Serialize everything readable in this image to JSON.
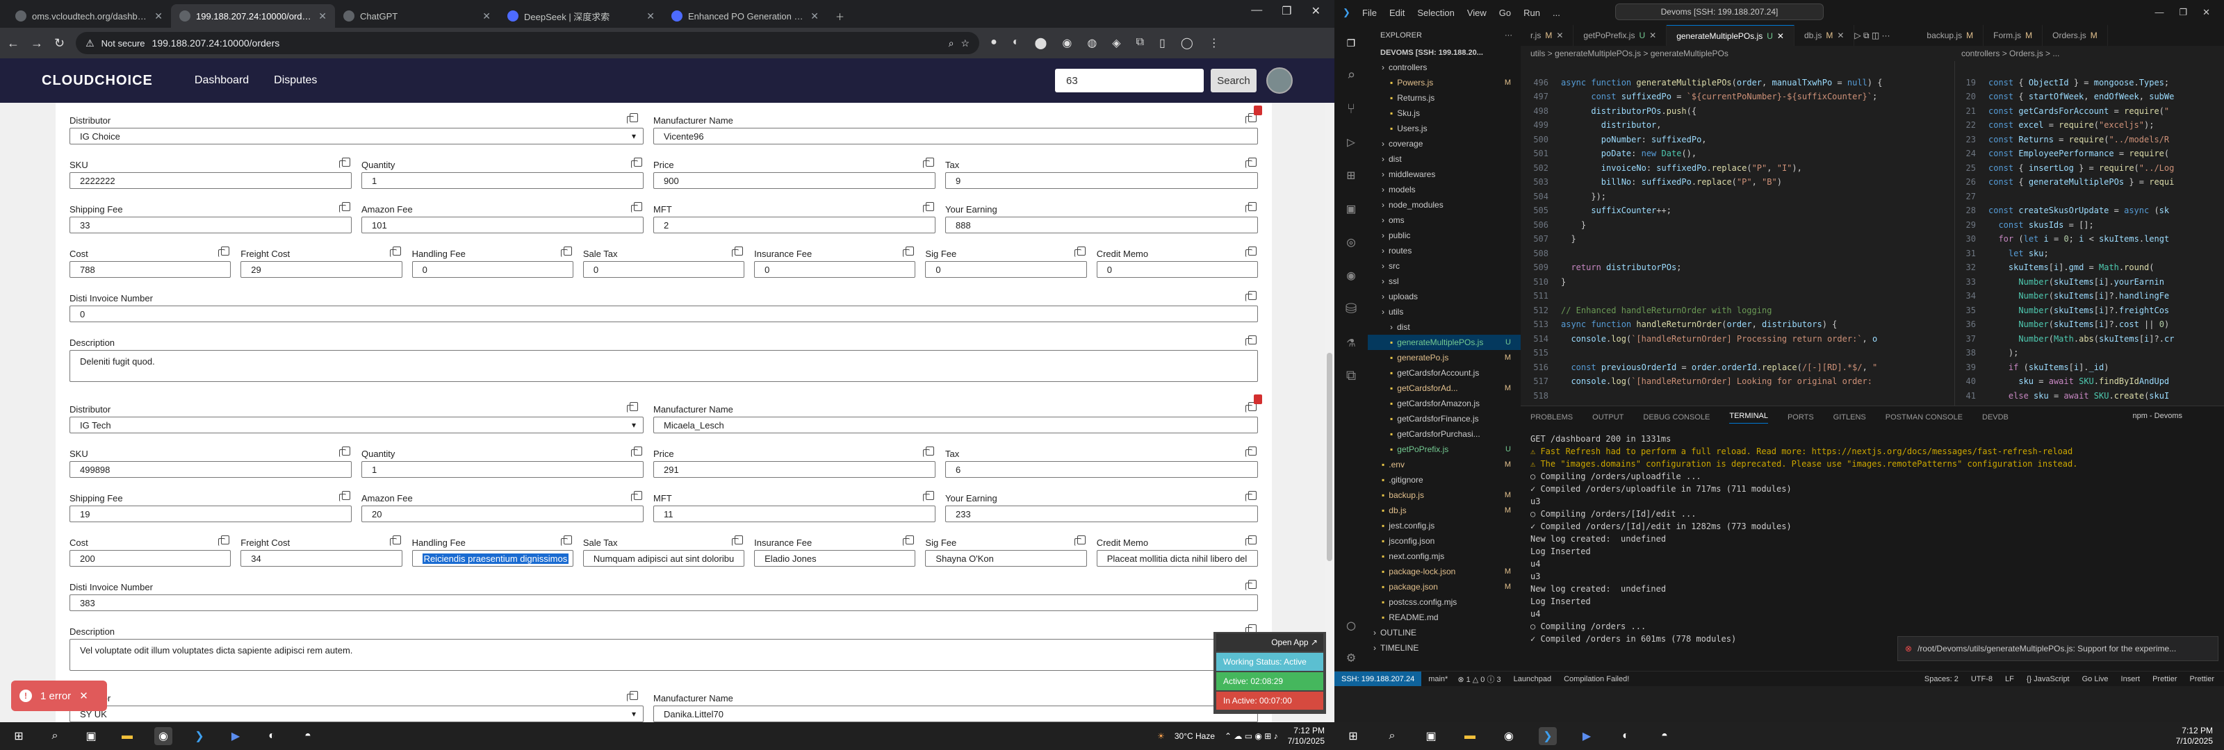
{
  "chrome": {
    "tabs": [
      {
        "title": "oms.vcloudtech.org/dashboard",
        "active": false
      },
      {
        "title": "199.188.207.24:10000/orders",
        "active": true
      },
      {
        "title": "ChatGPT",
        "active": false
      },
      {
        "title": "DeepSeek | 深度求索",
        "active": false
      },
      {
        "title": "Enhanced PO Generation for M",
        "active": false
      }
    ],
    "url_warning": "Not secure",
    "url": "199.188.207.24:10000/orders"
  },
  "app": {
    "logo": "CLOUDCHOICE",
    "nav": [
      "Dashboard",
      "Disputes"
    ],
    "search_value": "63",
    "search_button": "Search"
  },
  "labels": {
    "distributor": "Distributor",
    "manufacturer": "Manufacturer Name",
    "sku": "SKU",
    "quantity": "Quantity",
    "price": "Price",
    "tax": "Tax",
    "shipping": "Shipping Fee",
    "amazon": "Amazon Fee",
    "mft": "MFT",
    "earning": "Your Earning",
    "cost": "Cost",
    "freight": "Freight Cost",
    "handling": "Handling Fee",
    "saletax": "Sale Tax",
    "insurance": "Insurance Fee",
    "sig": "Sig Fee",
    "credit": "Credit Memo",
    "disti": "Disti Invoice Number",
    "description": "Description"
  },
  "items": [
    {
      "distributor": "IG Choice",
      "manufacturer": "Vicente96",
      "sku": "2222222",
      "quantity": "1",
      "price": "900",
      "tax": "9",
      "shipping": "33",
      "amazon": "101",
      "mft": "2",
      "earning": "888",
      "cost": "788",
      "freight": "29",
      "handling": "0",
      "saletax": "0",
      "insurance": "0",
      "sig": "0",
      "credit": "0",
      "disti": "0",
      "description": "Deleniti fugit quod."
    },
    {
      "distributor": "IG Tech",
      "manufacturer": "Micaela_Lesch",
      "sku": "499898",
      "quantity": "1",
      "price": "291",
      "tax": "6",
      "shipping": "19",
      "amazon": "20",
      "mft": "11",
      "earning": "233",
      "cost": "200",
      "freight": "34",
      "handling": "Reiciendis praesentium dignissimos",
      "saletax": "Numquam adipisci aut sint doloribu",
      "insurance": "Eladio Jones",
      "sig": "Shayna O'Kon",
      "credit": "Placeat mollitia dicta nihil libero del",
      "disti": "383",
      "description": "Vel voluptate odit illum voluptates dicta sapiente adipisci rem autem."
    },
    {
      "distributor": "SY UK",
      "manufacturer": "Danika.Littel70"
    }
  ],
  "overlay": {
    "error_count": "1 error",
    "open_app": "Open App ↗",
    "working": "Working Status: Active",
    "active": "Active: 02:08:29",
    "inactive": "In Active: 00:07:00"
  },
  "taskbar_left": {
    "weather": "30°C Haze",
    "time": "7:12 PM",
    "date": "7/10/2025"
  },
  "vscode": {
    "menu": [
      "File",
      "Edit",
      "Selection",
      "View",
      "Go",
      "Run",
      "..."
    ],
    "search": "Devoms [SSH: 199.188.207.24]",
    "explorer_title": "EXPLORER",
    "workspace": "DEVOMS [SSH: 199.188.20...",
    "files": [
      {
        "name": "controllers",
        "badge": "",
        "folder": true
      },
      {
        "name": "Powers.js",
        "badge": "M"
      },
      {
        "name": "Returns.js",
        "badge": ""
      },
      {
        "name": "Sku.js",
        "badge": ""
      },
      {
        "name": "Users.js",
        "badge": ""
      },
      {
        "name": "coverage",
        "badge": "",
        "folder": true
      },
      {
        "name": "dist",
        "badge": "",
        "folder": true
      },
      {
        "name": "middlewares",
        "badge": "",
        "folder": true
      },
      {
        "name": "models",
        "badge": "",
        "folder": true
      },
      {
        "name": "node_modules",
        "badge": "",
        "folder": true
      },
      {
        "name": "oms",
        "badge": "",
        "folder": true
      },
      {
        "name": "public",
        "badge": "",
        "folder": true
      },
      {
        "name": "routes",
        "badge": "",
        "folder": true
      },
      {
        "name": "src",
        "badge": "",
        "folder": true
      },
      {
        "name": "ssl",
        "badge": "",
        "folder": true
      },
      {
        "name": "uploads",
        "badge": "",
        "folder": true
      },
      {
        "name": "utils",
        "badge": "",
        "folder": true
      },
      {
        "name": "dist",
        "badge": "",
        "folder": true
      },
      {
        "name": "generateMultiplePOs.js",
        "badge": "U"
      },
      {
        "name": "generatePo.js",
        "badge": "M"
      },
      {
        "name": "getCardsforAccount.js",
        "badge": ""
      },
      {
        "name": "getCardsforAd...",
        "badge": "M"
      },
      {
        "name": "getCardsforAmazon.js",
        "badge": ""
      },
      {
        "name": "getCardsforFinance.js",
        "badge": ""
      },
      {
        "name": "getCardsforPurchasi...",
        "badge": ""
      },
      {
        "name": "getPoPrefix.js",
        "badge": "U"
      },
      {
        "name": ".env",
        "badge": "M"
      },
      {
        "name": ".gitignore",
        "badge": ""
      },
      {
        "name": "backup.js",
        "badge": "M"
      },
      {
        "name": "db.js",
        "badge": "M"
      },
      {
        "name": "jest.config.js",
        "badge": ""
      },
      {
        "name": "jsconfig.json",
        "badge": ""
      },
      {
        "name": "next.config.mjs",
        "badge": ""
      },
      {
        "name": "package-lock.json",
        "badge": "M"
      },
      {
        "name": "package.json",
        "badge": "M"
      },
      {
        "name": "postcss.config.mjs",
        "badge": ""
      },
      {
        "name": "README.md",
        "badge": ""
      },
      {
        "name": "OUTLINE",
        "badge": "",
        "folder": true
      },
      {
        "name": "TIMELINE",
        "badge": "",
        "folder": true
      }
    ],
    "tabs_left": [
      {
        "name": "r.js",
        "badge": "M",
        "active": false
      },
      {
        "name": "getPoPrefix.js",
        "badge": "U",
        "active": false
      },
      {
        "name": "generateMultiplePOs.js",
        "badge": "U",
        "active": true
      },
      {
        "name": "db.js",
        "badge": "M",
        "active": false
      }
    ],
    "tabs_right": [
      {
        "name": "backup.js",
        "badge": "M"
      },
      {
        "name": "Form.js",
        "badge": "M"
      },
      {
        "name": "Orders.js",
        "badge": "M"
      }
    ],
    "breadcrumb_left": "utils > generateMultiplePOs.js > generateMultiplePOs",
    "breadcrumb_right": "controllers > Orders.js > ...",
    "panel_tabs": [
      "PROBLEMS",
      "OUTPUT",
      "DEBUG CONSOLE",
      "TERMINAL",
      "PORTS",
      "GITLENS",
      "POSTMAN CONSOLE",
      "DEVDB"
    ],
    "terminal_name": "npm - Devoms",
    "terminal": [
      "GET /dashboard 200 in 1331ms",
      "⚠ Fast Refresh had to perform a full reload. Read more: https://nextjs.org/docs/messages/fast-refresh-reload",
      "⚠ The \"images.domains\" configuration is deprecated. Please use \"images.remotePatterns\" configuration instead.",
      "○ Compiling /orders/uploadfile ...",
      "✓ Compiled /orders/uploadfile in 717ms (711 modules)",
      "u3",
      "○ Compiling /orders/[Id]/edit ...",
      "✓ Compiled /orders/[Id]/edit in 1282ms (773 modules)",
      "New log created:  undefined",
      "Log Inserted",
      "u4",
      "u3",
      "New log created:  undefined",
      "Log Inserted",
      "u4",
      "○ Compiling /orders ...",
      "✓ Compiled /orders in 601ms (778 modules)",
      ""
    ],
    "toast": "/root/Devoms/utils/generateMultiplePOs.js: Support for the experime...",
    "status": {
      "remote": "SSH: 199.188.207.24",
      "branch": "main*",
      "problems": "⊗ 1 △ 0 ⓘ 3",
      "launchpad": "Launchpad",
      "compile": "Compilation Failed!",
      "right": [
        "Spaces: 2",
        "UTF-8",
        "LF",
        "{} JavaScript",
        "Go Live",
        "Insert",
        "Prettier",
        "Prettier"
      ]
    },
    "taskbar": {
      "time": "7:12 PM",
      "date": "7/10/2025"
    }
  }
}
